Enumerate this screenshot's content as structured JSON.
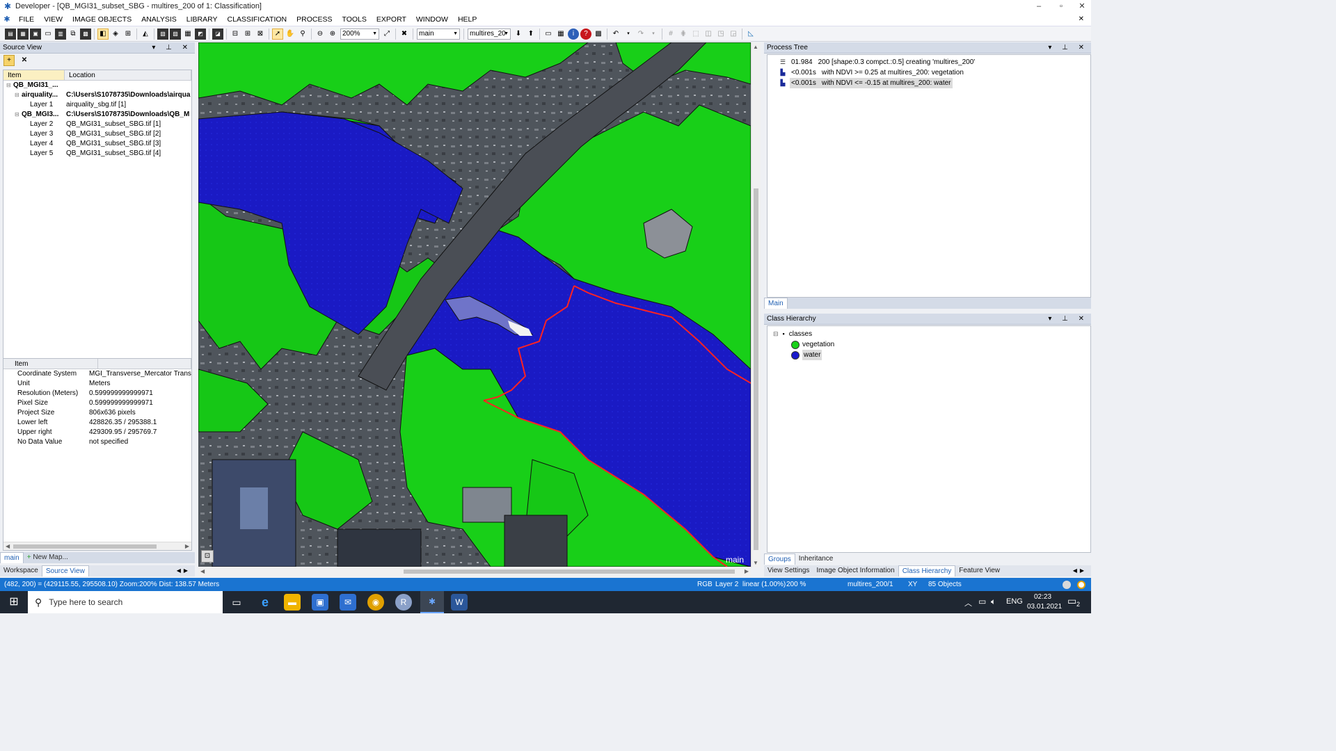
{
  "window": {
    "title": "Developer - [QB_MGI31_subset_SBG - multires_200 of 1: Classification]",
    "minimize": "–",
    "restore": "▫",
    "close": "✕",
    "doc_close": "✕"
  },
  "menu": [
    "FILE",
    "VIEW",
    "IMAGE OBJECTS",
    "ANALYSIS",
    "LIBRARY",
    "CLASSIFICATION",
    "PROCESS",
    "TOOLS",
    "EXPORT",
    "WINDOW",
    "HELP"
  ],
  "toolbar": {
    "zoom_value": "200%",
    "map_value": "main",
    "level_value": "multires_20"
  },
  "source_view": {
    "title": "Source View",
    "col_item": "Item",
    "col_location": "Location",
    "rows": [
      {
        "item": "QB_MGI31_...",
        "location": "",
        "bold": true,
        "indent": 0,
        "expander": "⊟"
      },
      {
        "item": "airquality...",
        "location": "C:\\Users\\S1078735\\Downloads\\airqua",
        "bold": true,
        "indent": 1,
        "expander": "⊟"
      },
      {
        "item": "Layer 1",
        "location": "airquality_sbg.tif [1]",
        "bold": false,
        "indent": 2,
        "expander": ""
      },
      {
        "item": "QB_MGI3...",
        "location": "C:\\Users\\S1078735\\Downloads\\QB_M",
        "bold": true,
        "indent": 1,
        "expander": "⊟"
      },
      {
        "item": "Layer 2",
        "location": "QB_MGI31_subset_SBG.tif [1]",
        "bold": false,
        "indent": 2,
        "expander": ""
      },
      {
        "item": "Layer 3",
        "location": "QB_MGI31_subset_SBG.tif [2]",
        "bold": false,
        "indent": 2,
        "expander": ""
      },
      {
        "item": "Layer 4",
        "location": "QB_MGI31_subset_SBG.tif [3]",
        "bold": false,
        "indent": 2,
        "expander": ""
      },
      {
        "item": "Layer 5",
        "location": "QB_MGI31_subset_SBG.tif [4]",
        "bold": false,
        "indent": 2,
        "expander": ""
      }
    ],
    "prop_header": "Item",
    "properties": [
      {
        "k": "Coordinate System",
        "v": "MGI_Transverse_Mercator  Trans"
      },
      {
        "k": "Unit",
        "v": "Meters"
      },
      {
        "k": "Resolution (Meters)",
        "v": "0.599999999999971"
      },
      {
        "k": "Pixel Size",
        "v": "0.599999999999971"
      },
      {
        "k": "Project Size",
        "v": "806x636 pixels"
      },
      {
        "k": "Lower left",
        "v": "428826.35 / 295388.1"
      },
      {
        "k": "Upper right",
        "v": "429309.95 / 295769.7"
      },
      {
        "k": "No Data Value",
        "v": "not specified"
      }
    ],
    "map_tabs": [
      "main",
      "New Map..."
    ],
    "bottom_tabs": [
      "Workspace",
      "Source View"
    ]
  },
  "map": {
    "label": "main"
  },
  "process_tree": {
    "title": "Process Tree",
    "rows": [
      {
        "time": "01.984",
        "text": "200 [shape:0.3 compct.:0.5] creating 'multires_200'",
        "selected": false
      },
      {
        "time": "<0.001s",
        "text": "with NDVI >= 0.25  at  multires_200: vegetation",
        "selected": false
      },
      {
        "time": "<0.001s",
        "text": "with NDVI <= -0.15  at  multires_200: water",
        "selected": true
      }
    ],
    "tab": "Main"
  },
  "class_hierarchy": {
    "title": "Class Hierarchy",
    "root": "classes",
    "classes": [
      {
        "name": "vegetation",
        "color": "#19d119",
        "selected": false
      },
      {
        "name": "water",
        "color": "#1a1acc",
        "selected": true
      }
    ],
    "tabs": [
      "Groups",
      "Inheritance"
    ],
    "bottom_tabs": [
      "View Settings",
      "Image Object Information",
      "Class Hierarchy",
      "Feature View"
    ]
  },
  "status": {
    "coords": "(482, 200) = (429115.55, 295508.10)  Zoom:200%  Dist: 138.57 Meters",
    "mode": "RGB",
    "layer": "Layer 2",
    "stretch": "linear (1.00%)",
    "zoom": "200 %",
    "level": "multires_200/1",
    "xy": "XY",
    "objects": "85 Objects"
  },
  "taskbar": {
    "search_placeholder": "Type here to search",
    "lang": "ENG",
    "time": "02:23",
    "date": "03.01.2021",
    "notifications": "2"
  },
  "colors": {
    "vegetation": "#19d119",
    "water": "#1a1acc",
    "urban": "#52575e",
    "selection_outline": "#ff2222",
    "statusbar": "#1a74d1"
  }
}
